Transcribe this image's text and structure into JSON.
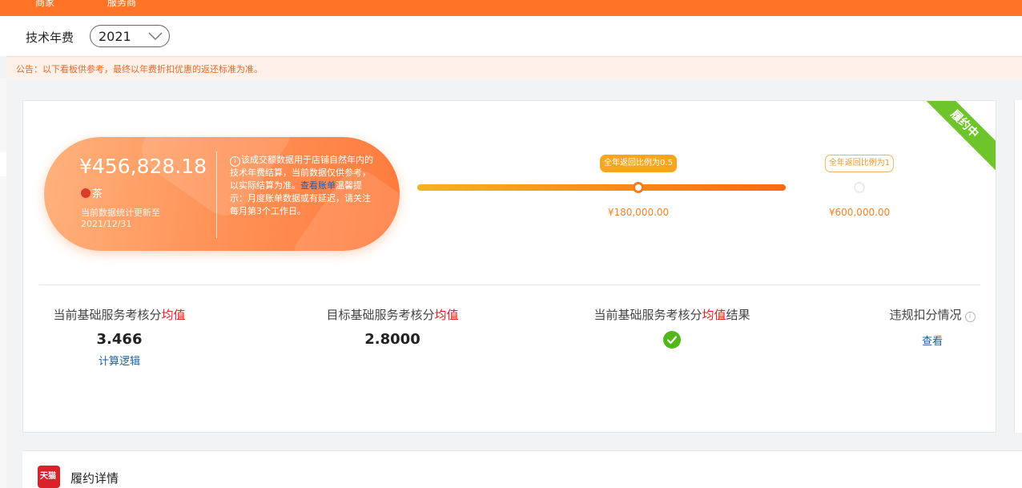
{
  "topbar": {
    "tab1": "商家",
    "tab2": "服务商"
  },
  "year_filter": {
    "label": "技术年费",
    "selected": "2021"
  },
  "notice": {
    "text": "公告：以下看板供参考，最终以年费折扣优惠的返还标准为准。"
  },
  "status_ribbon": "履约中",
  "summary": {
    "amount": "¥456,828.18",
    "category": "茶",
    "update_label": "当前数据统计更新至",
    "update_date": "2021/12/31",
    "desc_text": "该成交额数据用于店铺自然年内的技术年费结算，当前数据仅供参考，以实际结算为准。",
    "desc_link": "查看账单",
    "desc_tip": "温馨提示：月度账单数据或有延迟，请关注每月第3个工作日。"
  },
  "progress": {
    "fill_fraction": 1.0,
    "milestones": [
      {
        "label": "全年返回比例为0.5",
        "amount": "¥180,000.00",
        "reached": true,
        "position_fraction": 0.6
      },
      {
        "label": "全年返回比例为1",
        "amount": "¥600,000.00",
        "reached": false,
        "position_fraction": 1.2
      }
    ]
  },
  "metrics": {
    "current": {
      "label_prefix": "当前基础服务考核分",
      "label_highlight": "均值",
      "value": "3.466",
      "link": "计算逻辑"
    },
    "target": {
      "label_prefix": "目标基础服务考核分",
      "label_highlight": "均值",
      "value": "2.8000"
    },
    "result": {
      "label_prefix": "当前基础服务考核分",
      "label_highlight": "均值",
      "label_suffix": "结果",
      "status": "passed"
    },
    "violation": {
      "label": "违规扣分情况",
      "link": "查看"
    }
  },
  "fulfillment": {
    "badge": "天猫",
    "title": "履约详情"
  },
  "colors": {
    "brand_orange": "#ff7426",
    "highlight_red": "#e02020",
    "success_green": "#52b71a",
    "ribbon_green": "#6ec52b",
    "link_blue": "#1d5f9e"
  }
}
